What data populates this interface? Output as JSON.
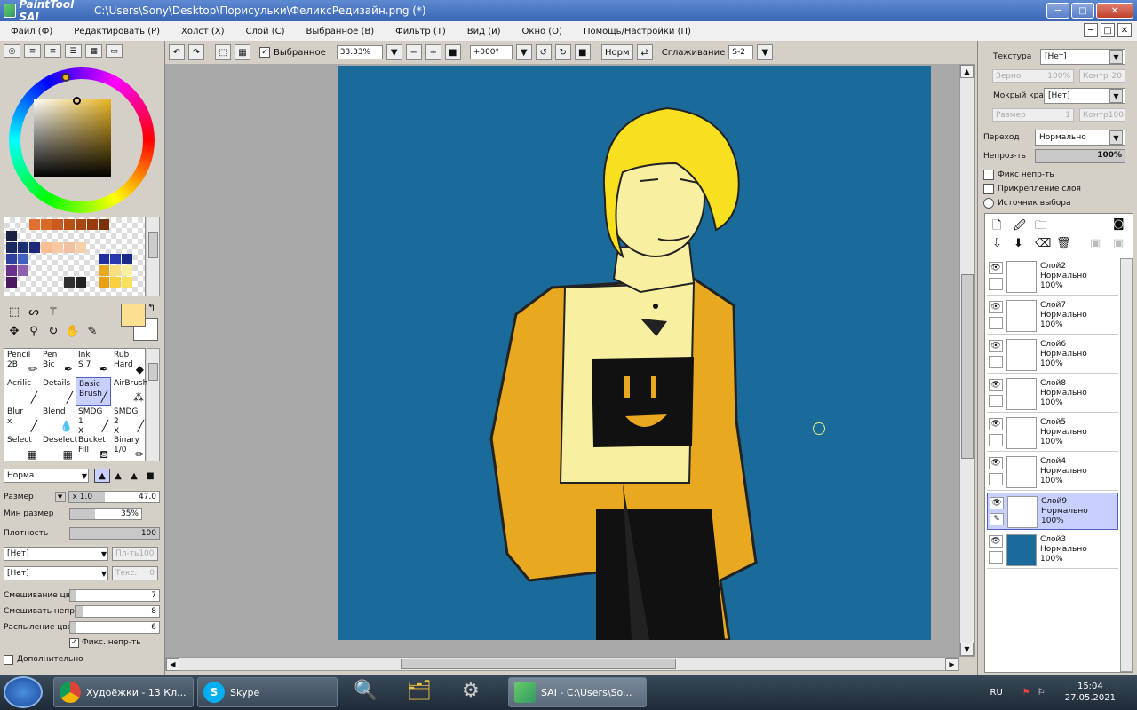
{
  "app": {
    "logo": "PaintTool SAI",
    "title": "C:\\Users\\Sony\\Desktop\\Порисульки\\ФеликсРедизайн.png (*)"
  },
  "window_buttons": {
    "minimize": "─",
    "maximize": "□",
    "close": "✕"
  },
  "menu": [
    "Файл (Ф)",
    "Редактировать (Р)",
    "Холст (Х)",
    "Слой (С)",
    "Выбранное (В)",
    "Фильтр (Т)",
    "Вид (и)",
    "Окно (О)",
    "Помощь/Настройки (П)"
  ],
  "toolbar": {
    "selected_label": "Выбранное",
    "zoom": "33.33%",
    "rotation": "+000°",
    "blend": "Норм",
    "smoothing_label": "Сглаживание",
    "smoothing_value": "S-2"
  },
  "colors": {
    "foreground": "#fae090",
    "background": "#ffffff",
    "canvas": "#1a6a9a",
    "hue": "#e8b420"
  },
  "brushes": [
    {
      "name": "Pencil",
      "size": "2B"
    },
    {
      "name": "Pen",
      "size": "Bic"
    },
    {
      "name": "Ink",
      "size": "S 7"
    },
    {
      "name": "Rub",
      "size": "Hard"
    },
    {
      "name": "Acrilic",
      "size": ""
    },
    {
      "name": "Details",
      "size": ""
    },
    {
      "name": "Basic",
      "size": "Brush"
    },
    {
      "name": "AirBrush",
      "size": ""
    },
    {
      "name": "Blur",
      "size": "x"
    },
    {
      "name": "Blend",
      "size": ""
    },
    {
      "name": "SMDG 1",
      "size": "X"
    },
    {
      "name": "SMDG 2",
      "size": "X"
    },
    {
      "name": "Select",
      "size": ""
    },
    {
      "name": "Deselect",
      "size": ""
    },
    {
      "name": "Bucket",
      "size": "Fill"
    },
    {
      "name": "Binary",
      "size": "1/0"
    }
  ],
  "brush_settings": {
    "mode": "Норма",
    "size_label": "Размер",
    "size_mult": "x 1.0",
    "size_value": "47.0",
    "min_size_label": "Мин размер",
    "min_size_value": "35%",
    "density_label": "Плотность",
    "density_value": "100",
    "texture1": "[Нет]",
    "texture1_dis": "Пл-ть100",
    "texture2": "[Нет]",
    "texture2_dis": "Текс.",
    "texture2_dis_val": "0",
    "mix_color_label": "Смешивание цвет",
    "mix_color_value": "7",
    "mix_opacity_label": "Смешивать непрс",
    "mix_opacity_value": "8",
    "blur_label": "Распыление цвет",
    "blur_value": "6",
    "fix_opacity_label": "Фикс. непр-ть",
    "advanced_label": "Дополнительно"
  },
  "right_panel": {
    "texture_label": "Текстура",
    "texture_value": "[Нет]",
    "grain_label": "Зерно",
    "grain_value": "100%",
    "contr_label": "Контр",
    "contr_value": "20",
    "wet_label": "Мокрый край",
    "wet_value": "[Нет]",
    "wsize_label": "Размер",
    "wsize_value": "1",
    "wcontr_label": "Контр",
    "wcontr_value": "100",
    "blend_label": "Переход",
    "blend_value": "Нормально",
    "opacity_label": "Непроз-ть",
    "opacity_value": "100%",
    "fix_label": "Фикс непр-ть",
    "clip_label": "Прикрепление слоя",
    "source_label": "Источник выбора"
  },
  "layers": [
    {
      "name": "Слой2",
      "mode": "Нормально",
      "opacity": "100%",
      "selected": false
    },
    {
      "name": "Слой7",
      "mode": "Нормально",
      "opacity": "100%",
      "selected": false
    },
    {
      "name": "Слой6",
      "mode": "Нормально",
      "opacity": "100%",
      "selected": false
    },
    {
      "name": "Слой8",
      "mode": "Нормально",
      "opacity": "100%",
      "selected": false
    },
    {
      "name": "Слой5",
      "mode": "Нормально",
      "opacity": "100%",
      "selected": false
    },
    {
      "name": "Слой4",
      "mode": "Нормально",
      "opacity": "100%",
      "selected": false
    },
    {
      "name": "Слой9",
      "mode": "Нормально",
      "opacity": "100%",
      "selected": true
    },
    {
      "name": "Слой3",
      "mode": "Нормально",
      "opacity": "100%",
      "selected": false
    }
  ],
  "taskbar": {
    "tasks": [
      {
        "label": "Худоёжки - 13 Кл..."
      },
      {
        "label": "Skype"
      },
      {
        "label": "SAI - C:\\Users\\So..."
      }
    ],
    "lang": "RU",
    "time": "15:04",
    "date": "27.05.2021"
  }
}
